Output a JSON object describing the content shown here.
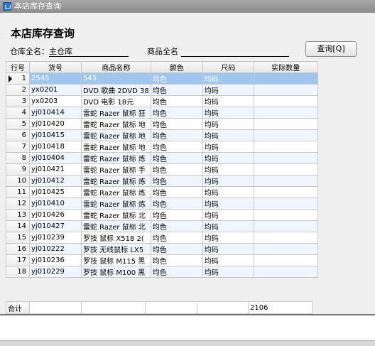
{
  "window": {
    "title": "本店库存查询",
    "icon": "app-icon"
  },
  "page": {
    "title": "本店库存查询"
  },
  "filters": {
    "warehouse_label": "仓库全名：",
    "warehouse_value": "主仓库",
    "product_label": "商品全名",
    "product_value": "",
    "query_button": "查询[Q]"
  },
  "table": {
    "columns": [
      "行号",
      "货号",
      "商品名称",
      "颜色",
      "尺码",
      "实际数量"
    ],
    "rows": [
      [
        "1",
        "2545",
        "545",
        "均色",
        "均码",
        ""
      ],
      [
        "2",
        "yx0201",
        "DVD 歌曲 2DVD 38",
        "均色",
        "均码",
        ""
      ],
      [
        "3",
        "yx0203",
        "DVD 电影 18元",
        "均色",
        "均码",
        ""
      ],
      [
        "4",
        "yj010414",
        "雷蛇 Razer 鼠标 狂",
        "均色",
        "均码",
        ""
      ],
      [
        "5",
        "yj010420",
        "雷蛇 Razer 鼠标 地",
        "均色",
        "均码",
        ""
      ],
      [
        "6",
        "yj010415",
        "雷蛇 Razer 鼠标 地",
        "均色",
        "均码",
        ""
      ],
      [
        "7",
        "yj010418",
        "雷蛇 Razer 鼠标 地",
        "均色",
        "均码",
        ""
      ],
      [
        "8",
        "yj010404",
        "雷蛇 Razer 鼠标 炼",
        "均色",
        "均码",
        ""
      ],
      [
        "9",
        "yj010421",
        "雷蛇 Razer 鼠标 手",
        "均色",
        "均码",
        ""
      ],
      [
        "10",
        "yj010412",
        "雷蛇 Razer 鼠标 炼",
        "均色",
        "均码",
        ""
      ],
      [
        "11",
        "yj010425",
        "雷蛇 Razer 鼠标 炼",
        "均色",
        "均码",
        ""
      ],
      [
        "12",
        "yj010410",
        "雷蛇 Razer 鼠标 炼",
        "均色",
        "均码",
        ""
      ],
      [
        "13",
        "yj010426",
        "雷蛇 Razer 鼠标 北",
        "均色",
        "均码",
        ""
      ],
      [
        "14",
        "yj010427",
        "雷蛇 Razer 鼠标 北",
        "均色",
        "均码",
        ""
      ],
      [
        "15",
        "yj010239",
        "罗技 鼠标 X518 2(",
        "均色",
        "均码",
        ""
      ],
      [
        "16",
        "yj010222",
        "罗技 无线鼠标 LX5",
        "均色",
        "均码",
        ""
      ],
      [
        "17",
        "yj010236",
        "罗技 鼠标 M115 黑",
        "均色",
        "均码",
        ""
      ],
      [
        "18",
        "yj010229",
        "罗技 鼠标 M100 黑",
        "均色",
        "均码",
        ""
      ]
    ],
    "selected_row": 0,
    "row_pointer_icon": "row-pointer-icon"
  },
  "summary": {
    "label": "合计",
    "total_quantity": "2106"
  }
}
